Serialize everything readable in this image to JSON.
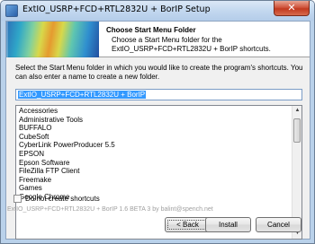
{
  "window": {
    "title": "ExtIO_USRP+FCD+RTL2832U + BorIP Setup",
    "close_glyph": "✕"
  },
  "header": {
    "title": "Choose Start Menu Folder",
    "subtitle": "Choose a Start Menu folder for the ExtIO_USRP+FCD+RTL2832U + BorIP shortcuts."
  },
  "instructions": "Select the Start Menu folder in which you would like to create the program's shortcuts. You can also enter a name to create a new folder.",
  "folder_input": {
    "value": "ExtIO_USRP+FCD+RTL2832U + BorIP"
  },
  "folder_list": {
    "items": [
      "Accessories",
      "Administrative Tools",
      "BUFFALO",
      "CubeSoft",
      "CyberLink PowerProducer 5.5",
      "EPSON",
      "Epson Software",
      "FileZilla FTP Client",
      "Freemake",
      "Games",
      "Google Chrome"
    ]
  },
  "checkbox": {
    "label": "Do not create shortcuts",
    "checked": false
  },
  "branding": "ExtIO_USRP+FCD+RTL2832U + BorIP 1.6 BETA 3 by balint@spench.net",
  "buttons": {
    "back": "< Back",
    "install": "Install",
    "cancel": "Cancel"
  },
  "colors": {
    "selection": "#3399ff",
    "title_bar": "#c3d8ef",
    "close_button": "#c23a1f"
  }
}
